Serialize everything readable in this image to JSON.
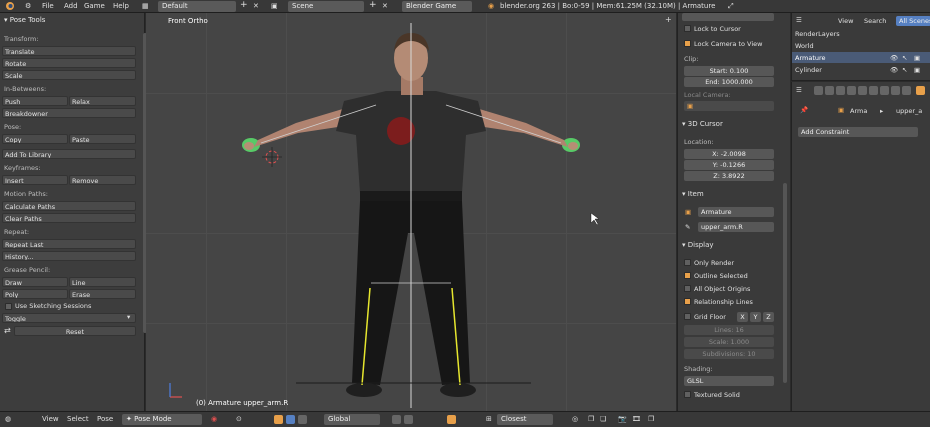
{
  "topbar": {
    "menus": [
      "File",
      "Add",
      "Game",
      "Help"
    ],
    "layout": "Default",
    "scene": "Scene",
    "engine": "Blender Game",
    "status": "blender.org 263 | Bo:0-59 | Mem:61.25M (32.10M) | Armature"
  },
  "toolshelf": {
    "title": "Pose Tools",
    "transform_label": "Transform:",
    "translate": "Translate",
    "rotate": "Rotate",
    "scale": "Scale",
    "inbetweens_label": "In-Betweens:",
    "push": "Push",
    "relax": "Relax",
    "breakdowner": "Breakdowner",
    "pose_label": "Pose:",
    "copy": "Copy",
    "paste": "Paste",
    "add_to_library": "Add To Library",
    "keyframes_label": "Keyframes:",
    "insert": "Insert",
    "remove": "Remove",
    "motion_paths_label": "Motion Paths:",
    "calculate_paths": "Calculate Paths",
    "clear_paths": "Clear Paths",
    "repeat_label": "Repeat:",
    "repeat_last": "Repeat Last",
    "history": "History...",
    "grease_pencil_label": "Grease Pencil:",
    "draw": "Draw",
    "line": "Line",
    "poly": "Poly",
    "erase": "Erase",
    "use_sketching": "Use Sketching Sessions",
    "toggle": "Toggle",
    "reset": "Reset"
  },
  "viewport": {
    "view_name": "Front Ortho",
    "object_info": "(0) Armature upper_arm.R"
  },
  "npanel": {
    "lock_to_cursor": "Lock to Cursor",
    "lock_camera": "Lock Camera to View",
    "clip_label": "Clip:",
    "clip_start": "Start: 0.100",
    "clip_end": "End: 1000.000",
    "local_camera": "Local Camera:",
    "cursor_header": "3D Cursor",
    "location_label": "Location:",
    "cx": "X: -2.0098",
    "cy": "Y: -0.1266",
    "cz": "Z: 3.8922",
    "item_header": "Item",
    "item_object": "Armature",
    "item_bone": "upper_arm.R",
    "display_header": "Display",
    "only_render": "Only Render",
    "outline_selected": "Outline Selected",
    "all_object_origins": "All Object Origins",
    "relationship_lines": "Relationship Lines",
    "grid_floor": "Grid Floor",
    "gx": "X",
    "gy": "Y",
    "gz": "Z",
    "lines": "Lines: 16",
    "scale": "Scale: 1.000",
    "subdivisions": "Subdivisions: 10",
    "shading_label": "Shading:",
    "shading_value": "GLSL",
    "textured_solid": "Textured Solid"
  },
  "outliner": {
    "view": "View",
    "search": "Search",
    "all_scenes": "All Scenes",
    "render_layers": "RenderLayers",
    "world": "World",
    "armature": "Armature",
    "cylinder": "Cylinder"
  },
  "props": {
    "object_name": "Arma",
    "bone_name": "upper_a",
    "add_constraint": "Add Constraint"
  },
  "bottombar": {
    "view": "View",
    "select": "Select",
    "pose": "Pose",
    "mode": "Pose Mode",
    "pivot": "Global",
    "snap": "Closest"
  },
  "colors": {
    "accent_orange": "#e8a04a",
    "selected_blue": "#5680c2",
    "bone_yellow": "#e6e62e",
    "hand_green": "#5ad86a"
  }
}
